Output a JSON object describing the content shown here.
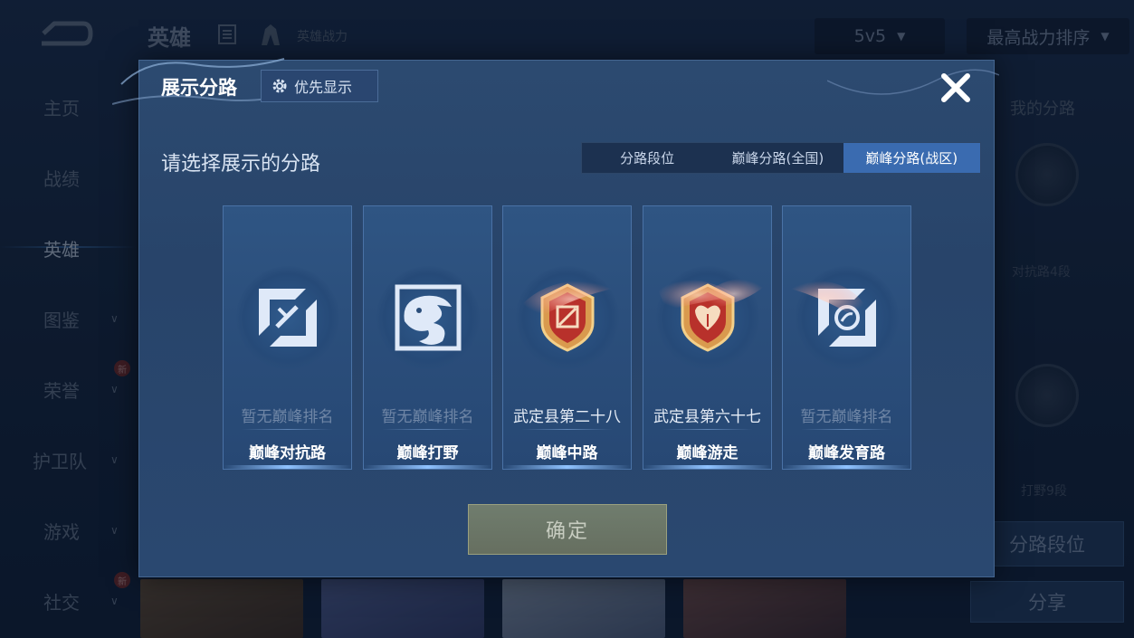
{
  "background": {
    "header": {
      "title": "英雄",
      "subtitle": "英雄战力",
      "mode_select": "5v5",
      "sort_select": "最高战力排序"
    },
    "sidebar": [
      {
        "label": "主页",
        "has_chevron": false
      },
      {
        "label": "战绩",
        "has_chevron": false
      },
      {
        "label": "英雄",
        "has_chevron": false,
        "active": true
      },
      {
        "label": "图鉴",
        "has_chevron": true
      },
      {
        "label": "荣誉",
        "has_chevron": true,
        "badge": "新"
      },
      {
        "label": "护卫队",
        "has_chevron": true
      },
      {
        "label": "游戏",
        "has_chevron": true
      },
      {
        "label": "社交",
        "has_chevron": true,
        "badge": "新"
      }
    ],
    "right_panel": {
      "title": "我的分路",
      "lane_1_label": "对抗路4段",
      "lane_2_label": "打野9段",
      "lane_rank_button": "分路段位",
      "share_button": "分享"
    }
  },
  "dialog": {
    "title": "展示分路",
    "priority_button": "优先显示",
    "prompt": "请选择展示的分路",
    "tabs": [
      {
        "label": "分路段位",
        "active": false
      },
      {
        "label": "巅峰分路(全国)",
        "active": false
      },
      {
        "label": "巅峰分路(战区)",
        "active": true
      }
    ],
    "cards": [
      {
        "rank": "暂无巅峰排名",
        "lane": "巅峰对抗路",
        "has_rank": false,
        "icon": "top-lane-icon"
      },
      {
        "rank": "暂无巅峰排名",
        "lane": "巅峰打野",
        "has_rank": false,
        "icon": "jungle-icon"
      },
      {
        "rank": "武定县第二十八",
        "lane": "巅峰中路",
        "has_rank": true,
        "icon": "mid-lane-badge-icon"
      },
      {
        "rank": "武定县第六十七",
        "lane": "巅峰游走",
        "has_rank": true,
        "icon": "roam-badge-icon"
      },
      {
        "rank": "暂无巅峰排名",
        "lane": "巅峰发育路",
        "has_rank": false,
        "icon": "bot-lane-icon"
      }
    ],
    "confirm_button": "确定"
  },
  "colors": {
    "dialog_bg": "#2c4a70",
    "active_tab": "#3a6bb0",
    "confirm_bg": "#6b7666",
    "badge_gold": "#d99a4e",
    "badge_red": "#b8312b"
  }
}
